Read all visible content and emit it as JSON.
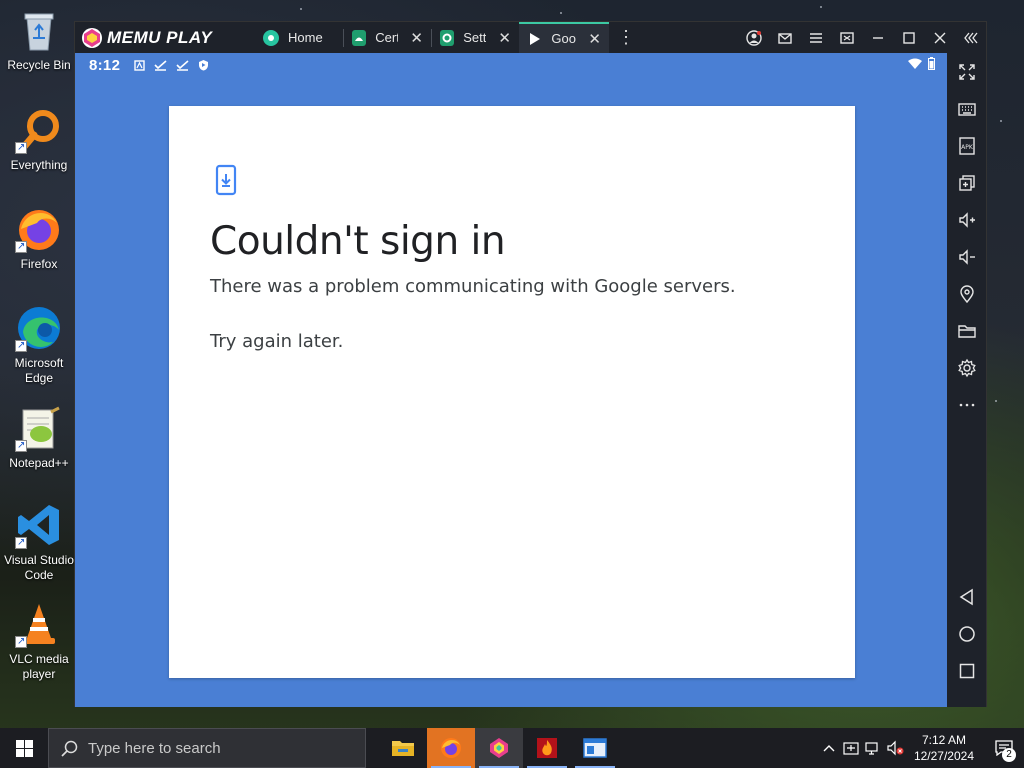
{
  "desktop": {
    "icons": [
      {
        "label": "Recycle Bin"
      },
      {
        "label": "Everything"
      },
      {
        "label": "Firefox"
      },
      {
        "label": "Microsoft Edge"
      },
      {
        "label": "Notepad++"
      },
      {
        "label": "Visual Studio Code"
      },
      {
        "label": "VLC media player"
      }
    ]
  },
  "emulator": {
    "brand": "MEMU PLAY",
    "tabs": [
      {
        "label": "Home",
        "icon": "home-app-icon",
        "color": "#27c4a0"
      },
      {
        "label": "Certi",
        "icon": "android-app-icon",
        "color": "#1f9e6e"
      },
      {
        "label": "Sett",
        "icon": "settings-app-icon",
        "color": "#1f9e6e"
      },
      {
        "label": "Goog",
        "icon": "google-play-icon",
        "color": "#ffffff"
      }
    ],
    "accent": "#3cc9a3"
  },
  "android": {
    "status_time": "8:12",
    "screen_bg": "#4a7fd4"
  },
  "dialog": {
    "title": "Couldn't sign in",
    "message": "There was a problem communicating with Google servers.",
    "retry": "Try again later."
  },
  "taskbar": {
    "search_placeholder": "Type here to search",
    "clock_time": "7:12 AM",
    "clock_date": "12/27/2024",
    "notification_count": "2"
  }
}
